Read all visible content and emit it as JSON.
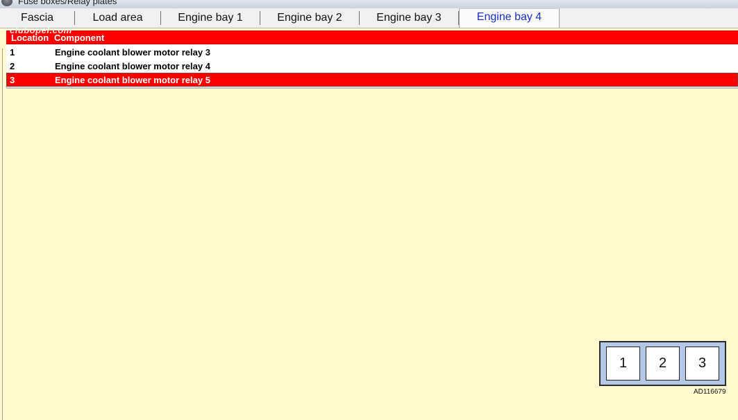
{
  "window": {
    "title": "Fuse boxes/Relay plates",
    "app_icon": "gear-icon"
  },
  "tabs": [
    {
      "label": "Fascia"
    },
    {
      "label": "Load area"
    },
    {
      "label": "Engine bay 1"
    },
    {
      "label": "Engine bay 2"
    },
    {
      "label": "Engine bay 3"
    },
    {
      "label": "Engine bay 4",
      "active": true
    }
  ],
  "watermark": "clubopel.com",
  "table": {
    "columns": [
      "Location",
      "Component"
    ],
    "rows": [
      {
        "location": "1",
        "component": "Engine coolant blower motor relay 3"
      },
      {
        "location": "2",
        "component": "Engine coolant blower motor relay 4"
      },
      {
        "location": "3",
        "component": "Engine coolant blower motor relay 5",
        "selected": true
      }
    ],
    "header_color": "#ff0000",
    "selected_color": "#ff0000"
  },
  "diagram": {
    "slots": [
      "1",
      "2",
      "3"
    ],
    "figure_id": "AD116679",
    "fill": "#b3c7e6"
  },
  "colors": {
    "background": "#fffacd",
    "active_tab_text": "#1a2fc8"
  }
}
